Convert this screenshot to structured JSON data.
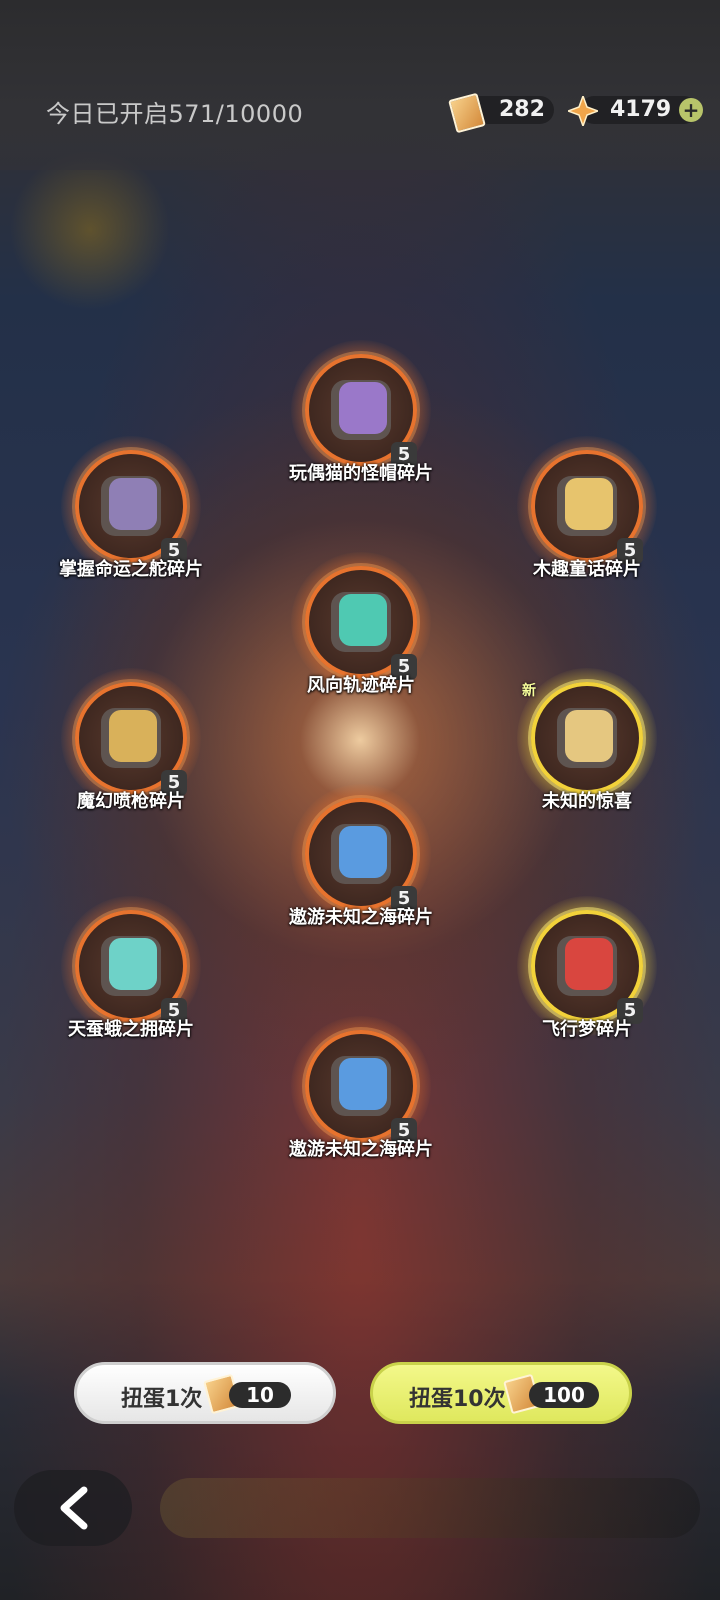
{
  "header": {
    "opened_label": "今日已开启571/10000",
    "ticket_count": "282",
    "crystal_count": "4179",
    "plus_label": "+"
  },
  "items": [
    {
      "name": "玩偶猫的怪帽碎片",
      "count": "5",
      "color": "#9a78c9"
    },
    {
      "name": "掌握命运之舵碎片",
      "count": "5",
      "color": "#8f7fb5"
    },
    {
      "name": "木趣童话碎片",
      "count": "5",
      "color": "#e7c46d"
    },
    {
      "name": "风向轨迹碎片",
      "count": "5",
      "color": "#4fc9b2"
    },
    {
      "name": "魔幻喷枪碎片",
      "count": "5",
      "color": "#d9b15a"
    },
    {
      "name": "未知的惊喜",
      "count": "",
      "color": "#e5c780",
      "new_label": "新"
    },
    {
      "name": "遨游未知之海碎片",
      "count": "5",
      "color": "#5a9be0"
    },
    {
      "name": "天蚕蛾之拥碎片",
      "count": "5",
      "color": "#6ed2c8"
    },
    {
      "name": "飞行梦碎片",
      "count": "5",
      "color": "#d9463f"
    },
    {
      "name": "遨游未知之海碎片",
      "count": "5",
      "color": "#5a9be0"
    }
  ],
  "buttons": {
    "gacha_1_label": "扭蛋1次",
    "gacha_1_cost": "10",
    "gacha_10_label": "扭蛋10次",
    "gacha_10_cost": "100"
  },
  "icons": {
    "back": "chevron-left-icon",
    "ticket": "ticket-icon",
    "crystal": "crystal-star-icon"
  }
}
